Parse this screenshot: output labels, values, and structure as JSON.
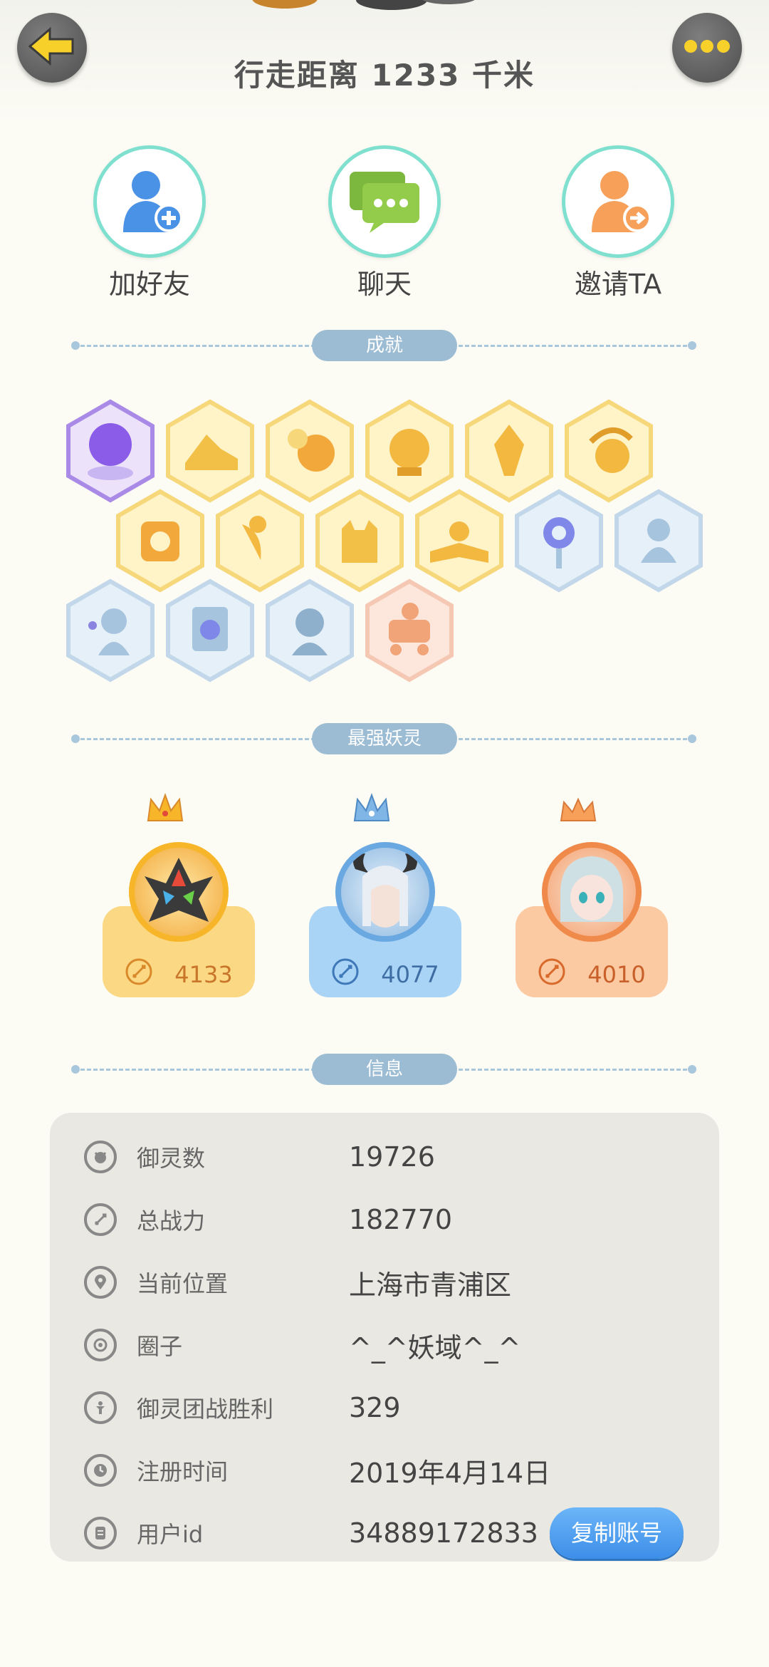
{
  "header": {
    "title": "行走距离 1233 千米"
  },
  "actions": [
    {
      "label": "加好友"
    },
    {
      "label": "聊天"
    },
    {
      "label": "邀请TA"
    }
  ],
  "sections": {
    "achievements": "成就",
    "top_spirits": "最强妖灵",
    "info": "信息"
  },
  "top_spirits": [
    {
      "score": "4133",
      "color": "#fbd883"
    },
    {
      "score": "4077",
      "color": "#aad4f6"
    },
    {
      "score": "4010",
      "color": "#fbc9a2"
    }
  ],
  "info": {
    "rows": [
      {
        "key": "御灵数",
        "value": "19726"
      },
      {
        "key": "总战力",
        "value": "182770"
      },
      {
        "key": "当前位置",
        "value": "上海市青浦区"
      },
      {
        "key": "圈子",
        "value": "^_^妖域^_^"
      },
      {
        "key": "御灵团战胜利",
        "value": "329"
      },
      {
        "key": "注册时间",
        "value": "2019年4月14日"
      },
      {
        "key": "用户id",
        "value": "34889172833"
      }
    ],
    "copy_button": "复制账号"
  }
}
